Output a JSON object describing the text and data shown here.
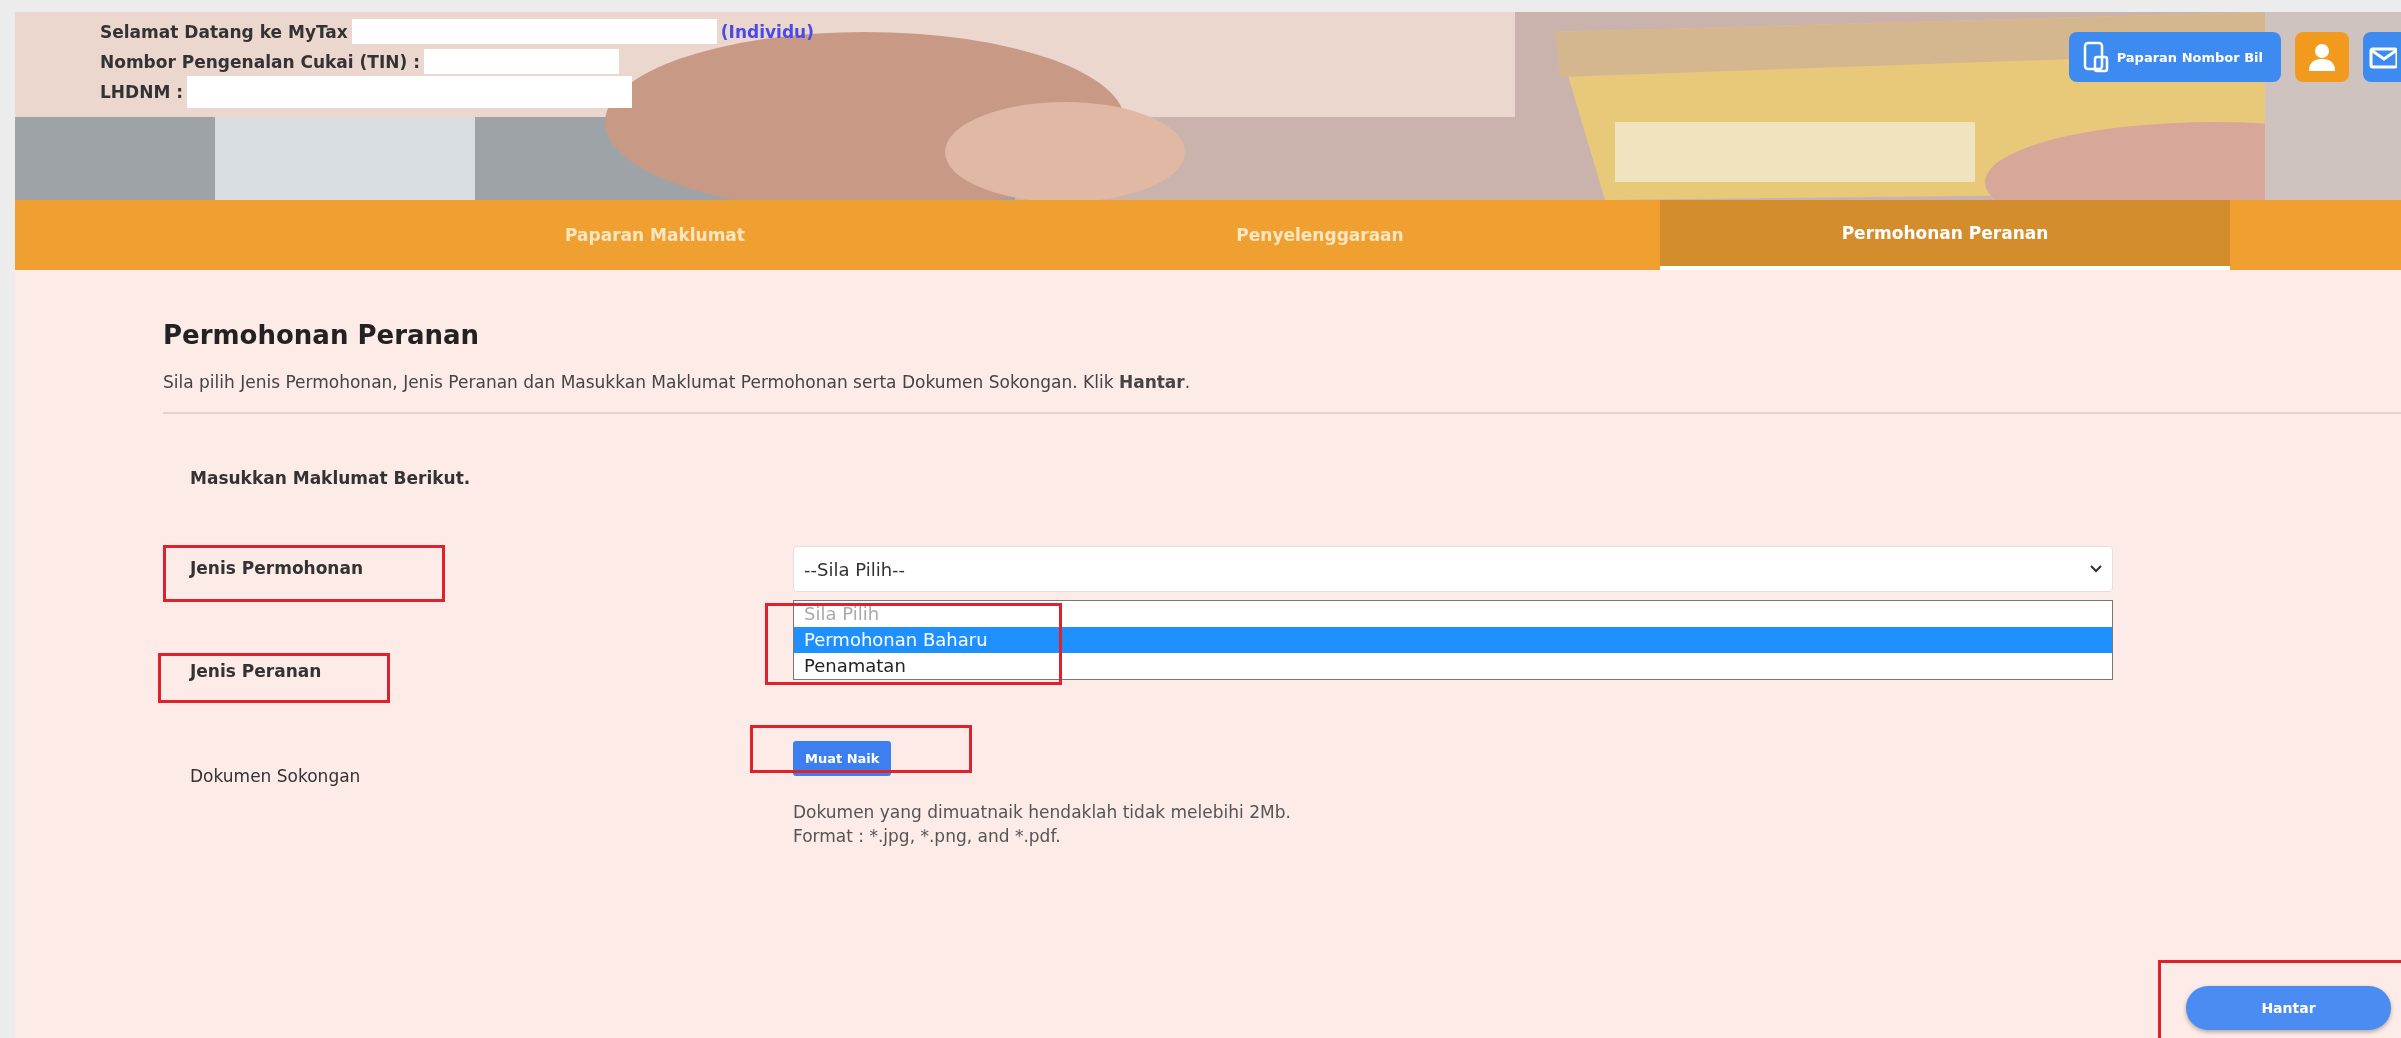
{
  "header": {
    "welcome": "Selamat Datang ke MyTax",
    "account_type": "(Individu)",
    "tin_label": "Nombor Pengenalan Cukai (TIN) :",
    "lhdnm_label": "LHDNM :",
    "bill_button": "Paparan Nombor Bil"
  },
  "tabs": [
    {
      "label": "Paparan Maklumat",
      "selected": false
    },
    {
      "label": "Penyelenggaraan",
      "selected": false
    },
    {
      "label": "Permohonan Peranan",
      "selected": true
    }
  ],
  "form": {
    "title": "Permohonan Peranan",
    "instructions": "Sila pilih Jenis Permohonan, Jenis Peranan dan Masukkan Maklumat Permohonan serta Dokumen Sokongan. Klik **Hantar**.",
    "section_label": "Masukkan Maklumat Berikut.",
    "fields": [
      {
        "kind": "dropdown",
        "label": "Jenis Permohonan",
        "value": "--Sila Pilih--",
        "options": [
          {
            "label": "Sila Pilih",
            "selected": false
          },
          {
            "label": "Permohonan Baharu",
            "selected": true
          },
          {
            "label": "Penamatan",
            "selected": false
          }
        ]
      },
      {
        "kind": "covered",
        "label": "Jenis Peranan"
      },
      {
        "kind": "upload",
        "label": "Dokumen Sokongan",
        "button": "Muat Naik",
        "notes": [
          "Dokumen yang dimuatnaik hendaklah tidak melebihi 2Mb.",
          "Format : *.jpg, *.png, and *.pdf."
        ]
      }
    ],
    "submit": "Hantar"
  }
}
